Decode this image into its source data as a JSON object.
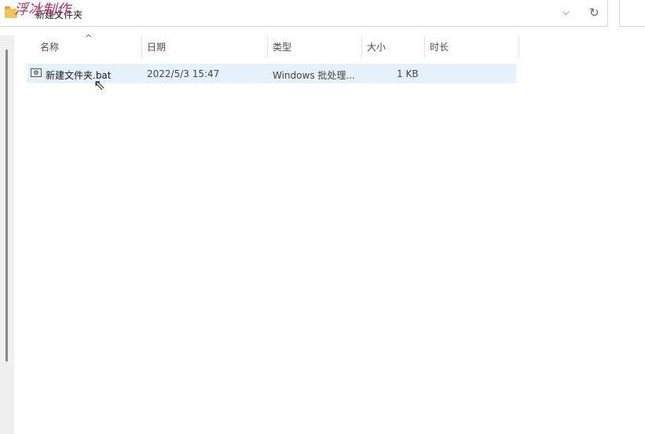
{
  "address": {
    "path": "新建文件夹",
    "watermark": "浮冰制作",
    "dropdown_icon": "chevron-down-icon",
    "refresh_icon": "refresh-icon"
  },
  "columns": [
    {
      "label": "名称"
    },
    {
      "label": "日期"
    },
    {
      "label": "类型"
    },
    {
      "label": "大小"
    },
    {
      "label": "时长"
    }
  ],
  "files": [
    {
      "name": "新建文件夹.bat",
      "date": "2022/5/3 15:47",
      "type": "Windows 批处理...",
      "size": "1 KB",
      "duration": ""
    }
  ]
}
